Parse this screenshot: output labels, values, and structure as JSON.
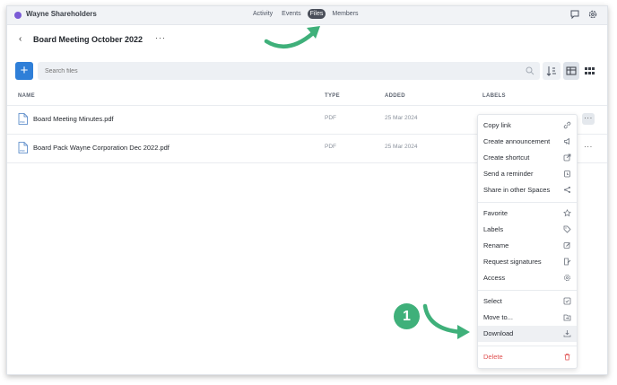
{
  "topbar": {
    "space_name": "Wayne Shareholders",
    "nav": [
      "Activity",
      "Events",
      "Files",
      "Members"
    ],
    "active_nav": "Files"
  },
  "header": {
    "title": "Board Meeting October 2022",
    "more": "···"
  },
  "toolbar": {
    "add_label": "+",
    "search_placeholder": "Search files"
  },
  "columns": {
    "name": "NAME",
    "type": "TYPE",
    "added": "ADDED",
    "labels": "LABELS"
  },
  "files": [
    {
      "name": "Board Meeting Minutes.pdf",
      "type": "PDF",
      "added": "25 Mar 2024"
    },
    {
      "name": "Board Pack Wayne Corporation Dec 2022.pdf",
      "type": "PDF",
      "added": "25 Mar 2024"
    }
  ],
  "row_more": "···",
  "menu": {
    "items": [
      {
        "label": "Copy link",
        "icon": "link-icon"
      },
      {
        "label": "Create announcement",
        "icon": "megaphone-icon"
      },
      {
        "label": "Create shortcut",
        "icon": "shortcut-icon"
      },
      {
        "label": "Send a reminder",
        "icon": "alarm-icon"
      },
      {
        "label": "Share in other Spaces",
        "icon": "share-icon"
      },
      {
        "label": "Favorite",
        "icon": "star-icon"
      },
      {
        "label": "Labels",
        "icon": "tag-icon"
      },
      {
        "label": "Rename",
        "icon": "edit-icon"
      },
      {
        "label": "Request signatures",
        "icon": "signature-icon"
      },
      {
        "label": "Access",
        "icon": "gear-icon"
      },
      {
        "label": "Select",
        "icon": "checkbox-icon"
      },
      {
        "label": "Move to...",
        "icon": "move-icon"
      },
      {
        "label": "Download",
        "icon": "download-icon"
      },
      {
        "label": "Delete",
        "icon": "trash-icon"
      }
    ],
    "highlighted": "Download"
  },
  "annotation": {
    "step_number": "1"
  },
  "colors": {
    "accent": "#2f7fd8",
    "arrow": "#3fb07a",
    "danger": "#e05252",
    "space_dot": "#7b5cd6"
  }
}
